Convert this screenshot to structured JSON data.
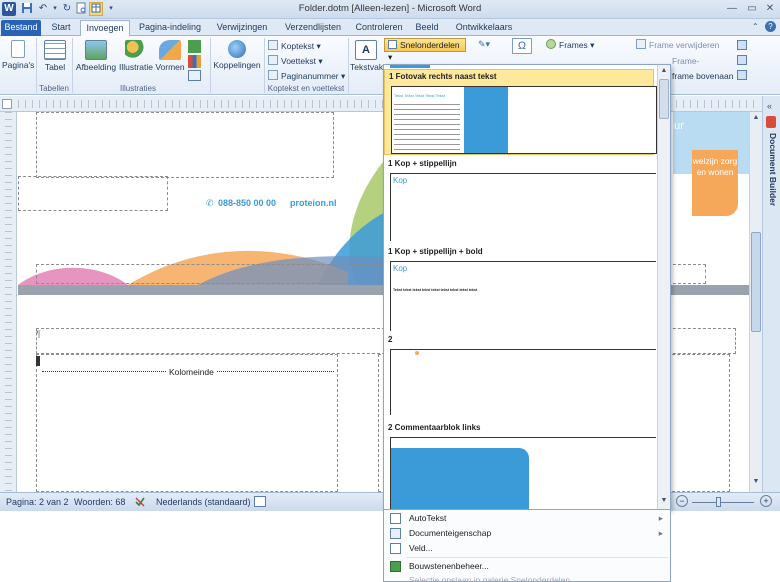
{
  "titlebar": {
    "title": "Folder.dotm [Alleen-lezen] - Microsoft Word",
    "app_icon": "W",
    "minimize": "—",
    "maximize": "▭",
    "close": "✕"
  },
  "tabs": [
    {
      "label": "Bestand"
    },
    {
      "label": "Start"
    },
    {
      "label": "Invoegen"
    },
    {
      "label": "Pagina-indeling"
    },
    {
      "label": "Verwijzingen"
    },
    {
      "label": "Verzendlijsten"
    },
    {
      "label": "Controleren"
    },
    {
      "label": "Beeld"
    },
    {
      "label": "Ontwikkelaars"
    }
  ],
  "ribbon": {
    "paginas": "Pagina's",
    "tabel": "Tabel",
    "afbeelding": "Afbeelding",
    "illustratie": "Illustratie",
    "vormen": "Vormen",
    "koppelingen": "Koppelingen",
    "koptekst": "Koptekst",
    "voettekst": "Voettekst",
    "paginanummer": "Paginanummer",
    "tekstvak": "Tekstvak",
    "snelonderdelen": "Snelonderdelen",
    "frames": "Frames",
    "frame_verwijderen": "Frame verwijderen",
    "frame_eigenschappen": "Frame-eigenschappen",
    "frame_bovenaan": "frame bovenaan",
    "groups": {
      "tabellen": "Tabellen",
      "illustraties": "Illustraties",
      "koptekst_voettekst": "Koptekst en voettekst"
    }
  },
  "document": {
    "phone_text": "088-850 00 00",
    "site_text": "proteion.nl",
    "kolomeinde": "Kolomeinde",
    "badge_text": "welzijn zorg en wonen",
    "partial_text": "nur"
  },
  "docbuilder": {
    "label": "Document Builder"
  },
  "gallery": {
    "items": [
      {
        "label": "1 Fotovak rechts naast tekst",
        "filler": "Tekst Tekst Tekst Tekst Tekst"
      },
      {
        "label": "1 Kop + stippellijn",
        "kop": "Kop"
      },
      {
        "label": "1 Kop + stippellijn + bold",
        "kop": "Kop",
        "filler": "Tekst tekst tekst tekst tekst tekst tekst tekst tekst"
      },
      {
        "label": "2"
      },
      {
        "label": "2 Commentaarblok links"
      }
    ]
  },
  "menu": {
    "items": [
      {
        "label": "AutoTekst"
      },
      {
        "label": "Documenteigenschap"
      },
      {
        "label": "Veld..."
      },
      {
        "label": "Bouwstenenbeheer..."
      },
      {
        "label": "Selectie opslaan in galerie Snelonderdelen..."
      }
    ]
  },
  "statusbar": {
    "page": "Pagina: 2 van 2",
    "words": "Woorden: 68",
    "language": "Nederlands (standaard)"
  },
  "colors": {
    "accent_blue": "#3b9bd8",
    "orange": "#f5a85a",
    "green": "#a8c96a",
    "pink": "#e07ab0",
    "highlight": "#fde89c",
    "file_tab": "#2a62b8"
  }
}
